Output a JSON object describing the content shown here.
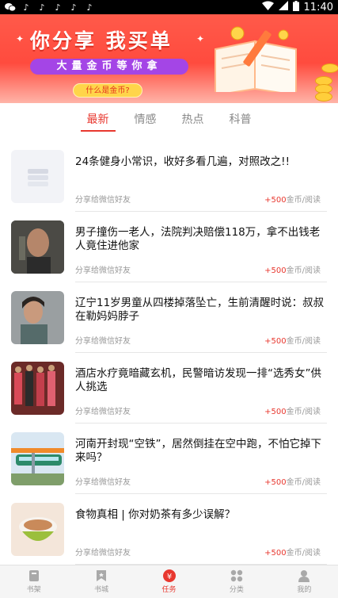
{
  "status_bar": {
    "time": "11:40",
    "app_icons": [
      "wechat-icon",
      "tiktok-icon",
      "tiktok-icon",
      "tiktok-icon",
      "tiktok-icon",
      "tiktok-icon"
    ]
  },
  "banner": {
    "slogan": "你分享 我买单",
    "subline": "大量金币等你拿",
    "button_label": "什么是金币?"
  },
  "tabs": [
    {
      "label": "最新",
      "active": true
    },
    {
      "label": "情感",
      "active": false
    },
    {
      "label": "热点",
      "active": false
    },
    {
      "label": "科普",
      "active": false
    }
  ],
  "articles": [
    {
      "title": "24条健身小常识，收好多看几遍，对照改之!!",
      "share": "分享给微信好友",
      "reward_amount": "+500",
      "reward_unit": "金币/阅读",
      "thumb": "placeholder"
    },
    {
      "title": "男子撞伤一老人，法院判决赔偿118万，拿不出钱老人竟住进他家",
      "share": "分享给微信好友",
      "reward_amount": "+500",
      "reward_unit": "金币/阅读",
      "thumb": "man"
    },
    {
      "title": "辽宁11岁男童从四楼掉落坠亡，生前清醒时说：叔叔在勒妈妈脖子",
      "share": "分享给微信好友",
      "reward_amount": "+500",
      "reward_unit": "金币/阅读",
      "thumb": "woman"
    },
    {
      "title": "酒店水疗竟暗藏玄机，民警暗访发现一排“选秀女”供人挑选",
      "share": "分享给微信好友",
      "reward_amount": "+500",
      "reward_unit": "金币/阅读",
      "thumb": "crowd"
    },
    {
      "title": "河南开封现“空铁”，居然倒挂在空中跑，不怕它掉下来吗？",
      "share": "分享给微信好友",
      "reward_amount": "+500",
      "reward_unit": "金币/阅读",
      "thumb": "train"
    },
    {
      "title": "食物真相 | 你对奶茶有多少误解？",
      "share": "分享给微信好友",
      "reward_amount": "+500",
      "reward_unit": "金币/阅读",
      "thumb": "tea"
    }
  ],
  "bottom_nav": [
    {
      "label": "书架",
      "icon": "bookshelf-icon",
      "active": false
    },
    {
      "label": "书城",
      "icon": "bookmark-icon",
      "active": false
    },
    {
      "label": "任务",
      "icon": "yuan-icon",
      "active": true
    },
    {
      "label": "分类",
      "icon": "grid-icon",
      "active": false
    },
    {
      "label": "我的",
      "icon": "user-icon",
      "active": false
    }
  ],
  "colors": {
    "accent": "#e8382f",
    "banner": "#ff4b3e",
    "pill": "#a445e6"
  }
}
